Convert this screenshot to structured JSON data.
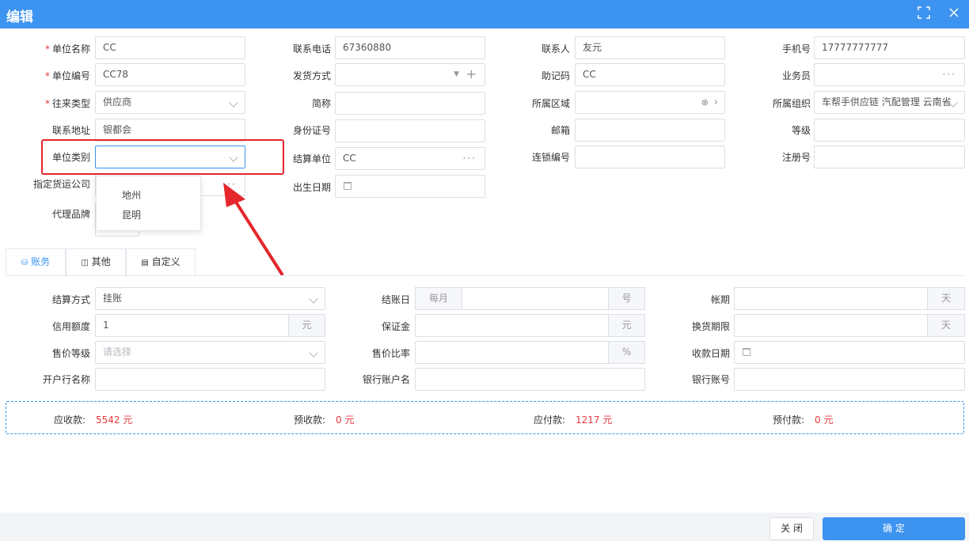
{
  "header": {
    "title": "编辑"
  },
  "form": {
    "unit_name": {
      "label": "单位名称",
      "value": "CC"
    },
    "phone": {
      "label": "联系电话",
      "value": "67360880"
    },
    "contact": {
      "label": "联系人",
      "value": "友元"
    },
    "mobile": {
      "label": "手机号",
      "value": "17777777777"
    },
    "unit_code": {
      "label": "单位编号",
      "value": "CC78"
    },
    "ship_method": {
      "label": "发货方式",
      "value": ""
    },
    "mnemonic": {
      "label": "助记码",
      "value": "CC"
    },
    "salesman": {
      "label": "业务员",
      "value": ""
    },
    "type": {
      "label": "往来类型",
      "value": "供应商"
    },
    "short_name": {
      "label": "简称",
      "value": ""
    },
    "region": {
      "label": "所属区域",
      "value": ""
    },
    "org": {
      "label": "所属组织",
      "value": "车帮手供应链 汽配管理 云南省"
    },
    "address": {
      "label": "联系地址",
      "value": "银都会"
    },
    "id_card": {
      "label": "身份证号",
      "value": ""
    },
    "email": {
      "label": "邮箱",
      "value": ""
    },
    "level": {
      "label": "等级",
      "value": ""
    },
    "category": {
      "label": "单位类别",
      "value": "",
      "options": [
        "地州",
        "昆明"
      ]
    },
    "settle_unit": {
      "label": "结算单位",
      "value": "CC"
    },
    "chain_code": {
      "label": "连锁编号",
      "value": ""
    },
    "reg_no": {
      "label": "注册号",
      "value": ""
    },
    "carrier": {
      "label": "指定货运公司"
    },
    "birth": {
      "label": "出生日期"
    },
    "brand": {
      "label": "代理品牌"
    }
  },
  "tabs": [
    {
      "label": "账务"
    },
    {
      "label": "其他"
    },
    {
      "label": "自定义"
    }
  ],
  "account": {
    "settle_method": {
      "label": "结算方式",
      "value": "挂账"
    },
    "close_day": {
      "label": "结账日",
      "prefix": "每月",
      "suffix": "号"
    },
    "term": {
      "label": "帐期",
      "suffix": "天"
    },
    "credit": {
      "label": "信用额度",
      "value": "1",
      "suffix": "元"
    },
    "deposit": {
      "label": "保证金",
      "suffix": "元"
    },
    "exchange_limit": {
      "label": "换货期限",
      "suffix": "天"
    },
    "price_level": {
      "label": "售价等级",
      "placeholder": "请选择"
    },
    "price_ratio": {
      "label": "售价比率",
      "suffix": "%"
    },
    "collect_date": {
      "label": "收款日期"
    },
    "bank_name": {
      "label": "开户行名称"
    },
    "bank_account_name": {
      "label": "银行账户名"
    },
    "bank_account": {
      "label": "银行账号"
    }
  },
  "summary": {
    "receivable": {
      "label": "应收款:",
      "value": "5542 元"
    },
    "prereceived": {
      "label": "预收款:",
      "value": "0 元"
    },
    "payable": {
      "label": "应付款:",
      "value": "1217 元"
    },
    "prepaid": {
      "label": "预付款:",
      "value": "0 元"
    }
  },
  "footer": {
    "close_label": "关 闭",
    "ok_label": "确 定"
  },
  "colors": {
    "primary": "#3d93f0",
    "highlight": "#e5262c",
    "value_red": "#e8383d"
  },
  "icons": {
    "fullscreen": "fullscreen-icon",
    "close": "close-icon"
  }
}
